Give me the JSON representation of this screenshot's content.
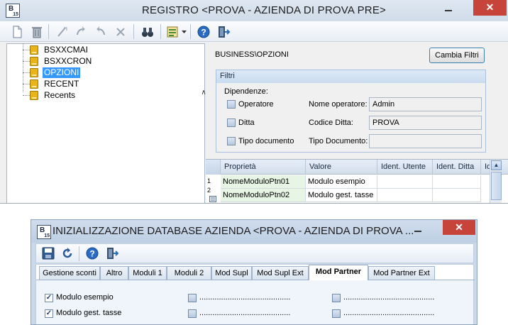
{
  "window1": {
    "title": "REGISTRO <PROVA - AZIENDA DI PROVA PRE>",
    "close_glyph": "✕",
    "toolbar_icons": [
      "new-icon",
      "delete-icon",
      "cut-icon",
      "copy-icon",
      "undo-icon",
      "cancel-icon",
      "find-binoculars-icon",
      "layout-dropdown-icon",
      "help-icon",
      "exit-icon"
    ],
    "tree": {
      "items": [
        {
          "label": "BSXXCMAI",
          "selected": false
        },
        {
          "label": "BSXXCRON",
          "selected": false
        },
        {
          "label": "OPZIONI",
          "selected": true
        },
        {
          "label": "RECENT",
          "selected": false
        },
        {
          "label": "Recents",
          "selected": false
        }
      ]
    },
    "path_label": "BUSINESS\\OPZIONI",
    "cambia_filtri": "Cambia Filtri",
    "filtri": {
      "header": "Filtri",
      "dipendenze": "Dipendenze:",
      "checks": [
        "Operatore",
        "Ditta",
        "Tipo documento"
      ],
      "fields": [
        {
          "label": "Nome operatore:",
          "value": "Admin"
        },
        {
          "label": "Codice Ditta:",
          "value": "PROVA"
        },
        {
          "label": "Tipo Documento:",
          "value": ""
        }
      ]
    },
    "grid": {
      "columns": [
        "Proprietà",
        "Valore",
        "Ident. Utente",
        "Ident. Ditta",
        "Id"
      ],
      "rows": [
        {
          "num": "1",
          "prop": "NomeModuloPtn01",
          "val": "Modulo esempio",
          "user": "",
          "ditta": ""
        },
        {
          "num": "2",
          "prop": "NomeModuloPtn02",
          "val": "Modulo gest. tasse",
          "user": "",
          "ditta": ""
        }
      ]
    }
  },
  "window2": {
    "title": "INIZIALIZZAZIONE DATABASE AZIENDA <PROVA - AZIENDA DI PROVA ...",
    "close_glyph": "✕",
    "toolbar_icons": [
      "save-icon",
      "refresh-icon",
      "help-icon",
      "exit-icon"
    ],
    "tabs": [
      "Gestione sconti",
      "Altro",
      "Moduli 1",
      "Moduli 2",
      "Mod Supl",
      "Mod Supl Ext",
      "Mod Partner",
      "Mod Partner Ext"
    ],
    "active_tab": "Mod Partner",
    "modules": [
      {
        "label": "Modulo esempio",
        "checked": true
      },
      {
        "label": "Modulo gest. tasse",
        "checked": true
      }
    ],
    "dots": ".........................................."
  }
}
